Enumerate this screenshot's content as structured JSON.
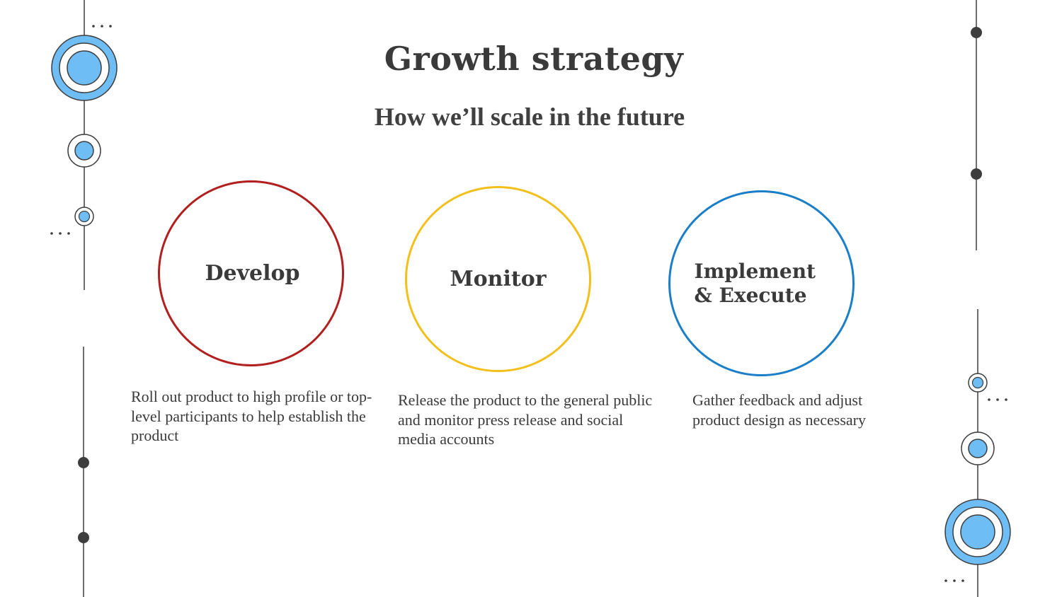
{
  "slide": {
    "title": "Growth strategy",
    "subtitle": "How we’ll scale in the future",
    "steps": [
      {
        "label": "Develop",
        "description": "Roll out product to high profile or top-level participants to help establish the product",
        "color": "#b21f1f"
      },
      {
        "label": "Monitor",
        "description": "Release the product to the general public and monitor press release and social media accounts",
        "color": "#f2c01d"
      },
      {
        "label": "Implement & Execute",
        "description": "Gather feedback and adjust product design as necessary",
        "color": "#1a7ec8"
      }
    ]
  },
  "theme": {
    "accent_light_blue": "#6fbdf5",
    "line_color": "#3d3d3d",
    "text_color": "#3a3a3a"
  }
}
